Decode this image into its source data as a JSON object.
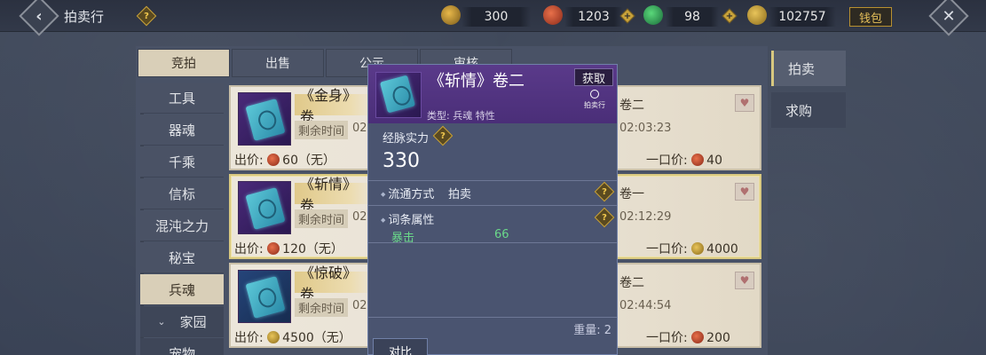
{
  "header": {
    "title": "拍卖行",
    "currencies": [
      {
        "icon": "gold-pouch-icon",
        "value": "300"
      },
      {
        "icon": "red-coin-icon",
        "value": "1203"
      },
      {
        "icon": "green-jade-icon",
        "value": "98"
      },
      {
        "icon": "gold-ingot-icon",
        "value": "102757"
      }
    ],
    "wallet_label": "钱包",
    "plus": "+"
  },
  "tabs": [
    "竞拍",
    "出售",
    "公示",
    "审核"
  ],
  "categories": [
    "工具",
    "器魂",
    "千乘",
    "信标",
    "混沌之力",
    "秘宝",
    "兵魂",
    "家园",
    "宠物"
  ],
  "category_expand": "⌄",
  "right_tabs": [
    "拍卖",
    "求购"
  ],
  "cards": [
    {
      "name": "《金身》卷",
      "time_label": "剩余时间",
      "time_partial": "02:",
      "price": "出价: ",
      "price_val": "60（无）",
      "right_name": "卷二",
      "right_time": "02:03:23",
      "buyout": "一口价: ",
      "buyout_val": "40"
    },
    {
      "name": "《斩情》卷",
      "time_label": "剩余时间",
      "time_partial": "02:",
      "price": "出价: ",
      "price_val": "120（无）",
      "right_name": "卷一",
      "right_time": "02:12:29",
      "buyout": "一口价: ",
      "buyout_val": "4000"
    },
    {
      "name": "《惊破》卷",
      "time_label": "剩余时间",
      "time_partial": "02:",
      "price": "出价: ",
      "price_val": "4500（无）",
      "right_name": "卷二",
      "right_time": "02:44:54",
      "buyout": "一口价: ",
      "buyout_val": "200"
    }
  ],
  "tooltip": {
    "name": "《斩情》卷二",
    "get_label": "获取",
    "auction_mini": "拍卖行",
    "type": "类型: 兵魂 特性",
    "power_label": "经脉实力",
    "power_value": "330",
    "circulation_label": "流通方式",
    "circulation_value": "拍卖",
    "attr_label": "词条属性",
    "crit_label": "暴击",
    "crit_value": "66",
    "weight": "重量: 2",
    "compare": "对比"
  },
  "colors": {
    "accent_gold": "#d8c880",
    "tooltip_header": "#5a3a8a",
    "crit_green": "#6ad88a"
  }
}
